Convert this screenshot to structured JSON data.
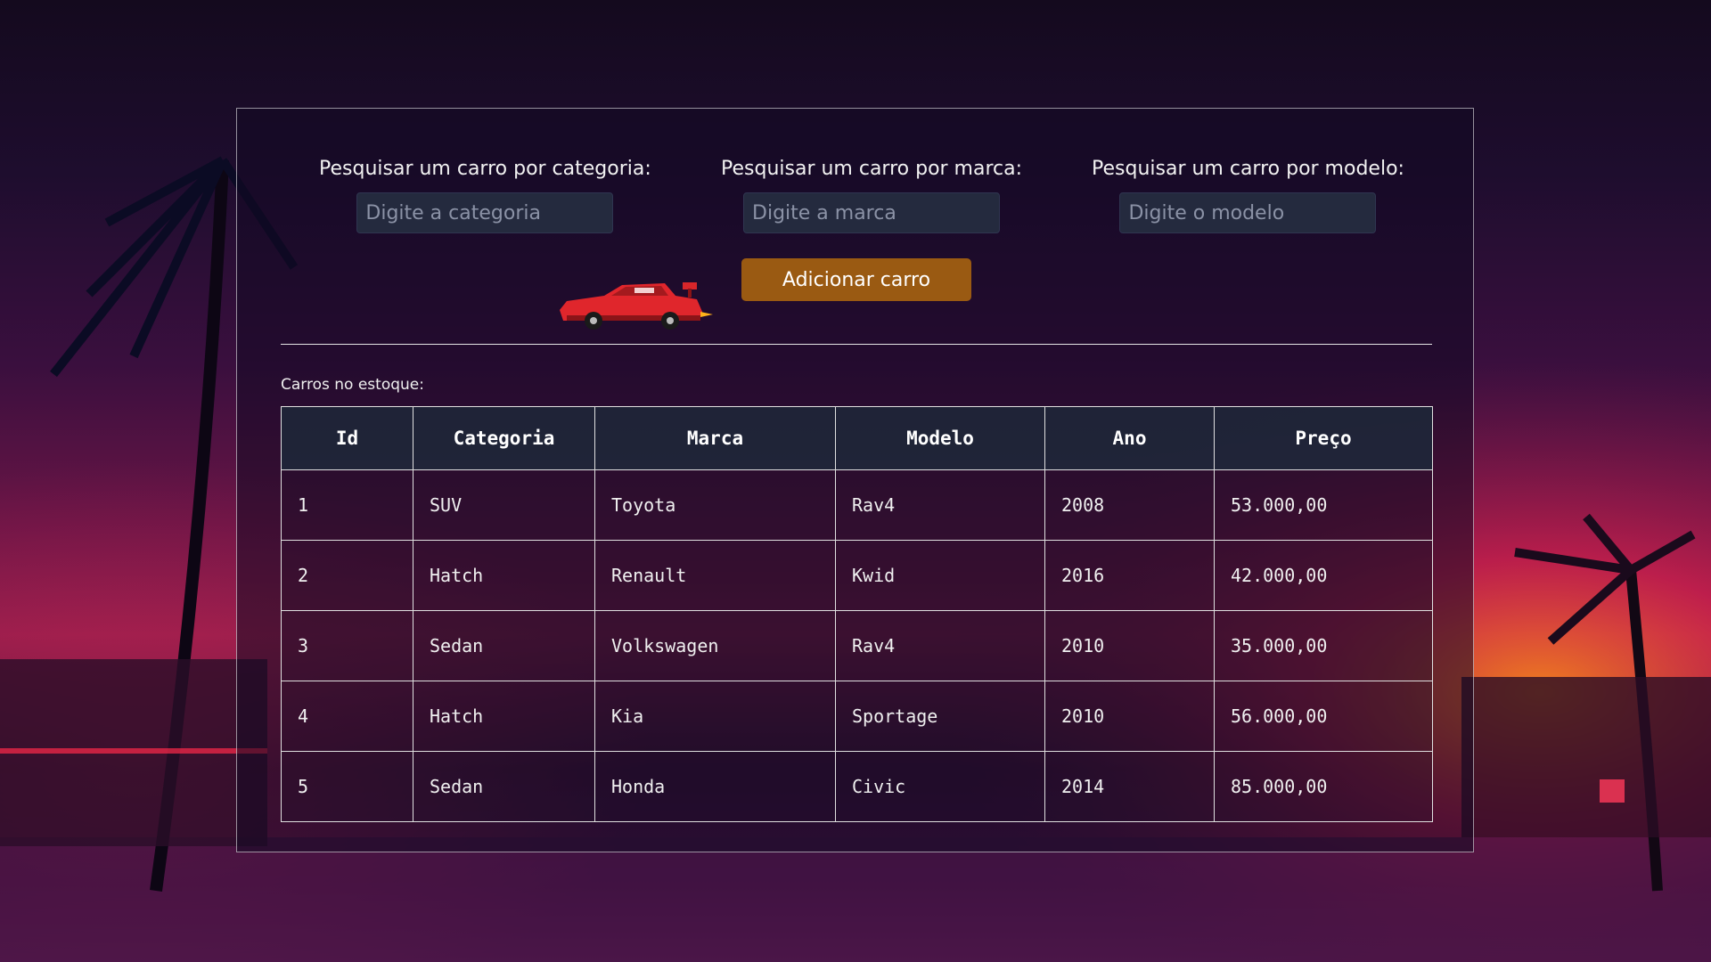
{
  "search": {
    "categoria": {
      "label": "Pesquisar um carro por categoria:",
      "placeholder": "Digite a categoria"
    },
    "marca": {
      "label": "Pesquisar um carro por marca:",
      "placeholder": "Digite a marca"
    },
    "modelo": {
      "label": "Pesquisar um carro por modelo:",
      "placeholder": "Digite o modelo"
    }
  },
  "add_button_label": "Adicionar carro",
  "car_icon": "red-sports-car-icon",
  "stock_label": "Carros no estoque:",
  "table": {
    "headers": [
      "Id",
      "Categoria",
      "Marca",
      "Modelo",
      "Ano",
      "Preço"
    ],
    "rows": [
      [
        "1",
        "SUV",
        "Toyota",
        "Rav4",
        "2008",
        "53.000,00"
      ],
      [
        "2",
        "Hatch",
        "Renault",
        "Kwid",
        "2016",
        "42.000,00"
      ],
      [
        "3",
        "Sedan",
        "Volkswagen",
        "Rav4",
        "2010",
        "35.000,00"
      ],
      [
        "4",
        "Hatch",
        "Kia",
        "Sportage",
        "2010",
        "56.000,00"
      ],
      [
        "5",
        "Sedan",
        "Honda",
        "Civic",
        "2014",
        "85.000,00"
      ]
    ]
  },
  "colors": {
    "accent_button": "#9a5a12",
    "input_bg": "#242a3e",
    "header_bg": "#1e2638"
  }
}
